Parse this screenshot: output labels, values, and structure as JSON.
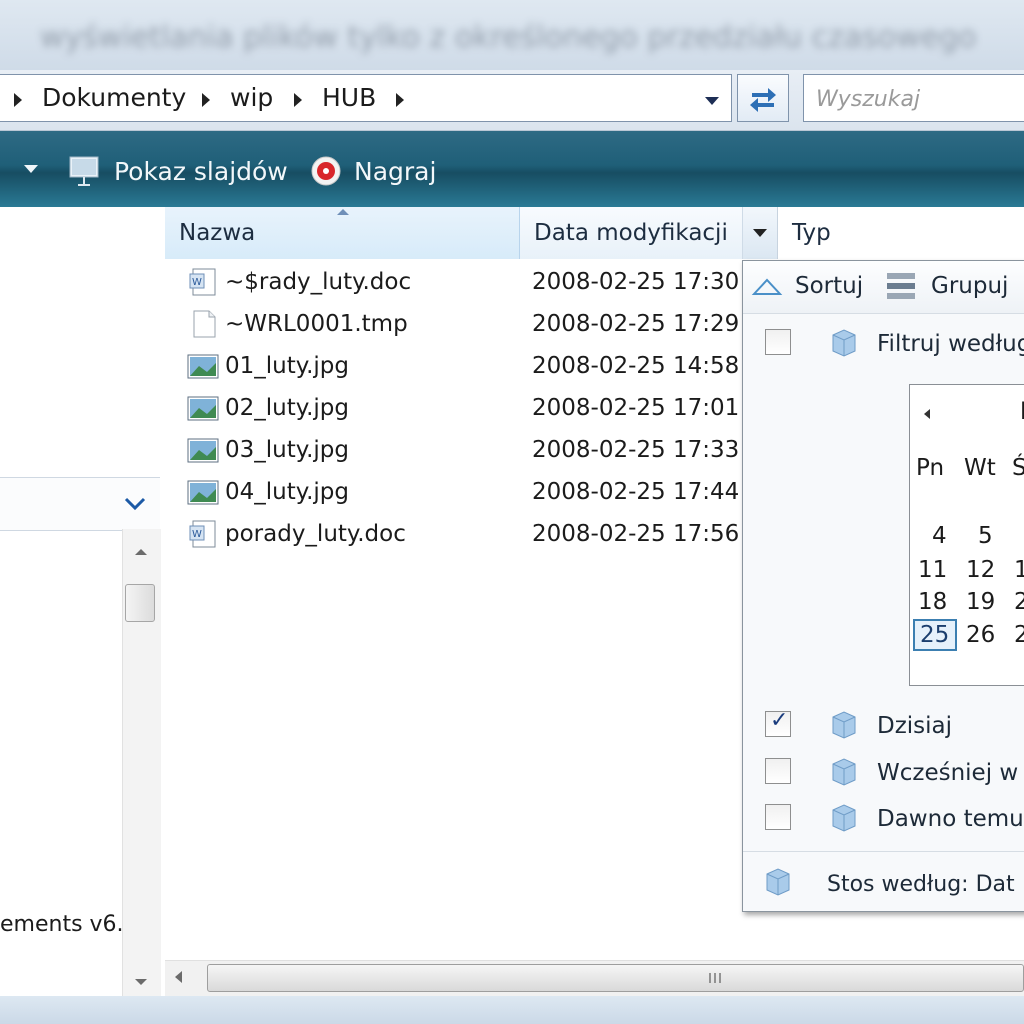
{
  "address": {
    "crumbs": [
      "Dokumenty",
      "wip",
      "HUB"
    ]
  },
  "search": {
    "placeholder": "Wyszukaj"
  },
  "toolbar": {
    "slideshow_label": "Pokaz slajdów",
    "record_label": "Nagraj"
  },
  "columns": {
    "name": "Nazwa",
    "date": "Data modyfikacji",
    "type": "Typ"
  },
  "files": [
    {
      "name": "~$rady_luty.doc",
      "date": "2008-02-25 17:30",
      "icon": "word-doc-icon"
    },
    {
      "name": "~WRL0001.tmp",
      "date": "2008-02-25 17:29",
      "icon": "blank-file-icon"
    },
    {
      "name": "01_luty.jpg",
      "date": "2008-02-25 14:58",
      "icon": "image-file-icon"
    },
    {
      "name": "02_luty.jpg",
      "date": "2008-02-25 17:01",
      "icon": "image-file-icon"
    },
    {
      "name": "03_luty.jpg",
      "date": "2008-02-25 17:33",
      "icon": "image-file-icon"
    },
    {
      "name": "04_luty.jpg",
      "date": "2008-02-25 17:44",
      "icon": "image-file-icon"
    },
    {
      "name": "porady_luty.doc",
      "date": "2008-02-25 17:56",
      "icon": "word-doc-icon"
    }
  ],
  "nav": {
    "tree_text": "ements v6."
  },
  "filter_panel": {
    "sort_label": "Sortuj",
    "group_label": "Grupuj",
    "filter_by": "Filtruj według",
    "calendar": {
      "month_label": "l",
      "weekdays": [
        "Pn",
        "Wt",
        "Ś"
      ],
      "weeks": [
        [
          "4",
          "5",
          ""
        ],
        [
          "11",
          "12",
          "1"
        ],
        [
          "18",
          "19",
          "2"
        ],
        [
          "25",
          "26",
          "2"
        ]
      ],
      "today": "25"
    },
    "options": [
      {
        "label": "Dzisiaj",
        "checked": true
      },
      {
        "label": "Wcześniej w t",
        "checked": false
      },
      {
        "label": "Dawno temu",
        "checked": false
      }
    ],
    "stack_label": "Stos według: Dat"
  }
}
